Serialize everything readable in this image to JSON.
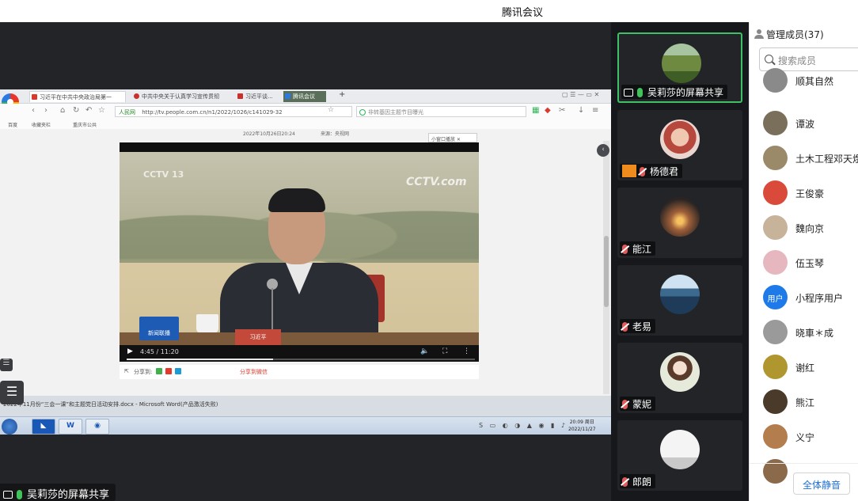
{
  "title": "腾讯会议",
  "stage": {
    "sharer_label": "吴莉莎的屏幕共享",
    "browser": {
      "tabs": [
        {
          "label": "习近平在中共中央政治局第一",
          "icon_color": "#d83a2e"
        },
        {
          "label": "中共中央关于认真学习宣传贯彻",
          "icon_color": "#c9302c"
        },
        {
          "label": "习近平谈...",
          "icon_color": "#c9302c"
        },
        {
          "label": "腾讯会议",
          "icon_color": "#2a7ae2"
        }
      ],
      "url_site": "人民网",
      "url": "http://tv.people.com.cn/n1/2022/1026/c141029-32",
      "search_text": "非转基因主题节目曝光",
      "bookmarks": [
        "百度",
        "收藏夹栏",
        "重庆市公共"
      ],
      "page_date": "2022年10月26日20:24",
      "page_source": "来源：央视网",
      "mini_window": "小窗口播放",
      "video": {
        "channel_logo": "CCTV.com",
        "channel_number": "CCTV 13",
        "news_logo": "新闻联播",
        "nameplate": "习近平",
        "time": "4:45 / 11:20",
        "progress": 0.42
      },
      "share_label": "分享到:",
      "wechat_share": "分享到微信",
      "doc_item": "2022年11月份“三会一课”和主题党日活动安排.docx - Microsoft Word(产品激活失败)",
      "clock_time": "20:09 周日",
      "clock_date": "2022/11/27",
      "taskbar_word": "W"
    }
  },
  "video_tiles": [
    {
      "name": "吴莉莎的屏幕共享",
      "avatar": "field",
      "mic": "on",
      "active": true
    },
    {
      "name": "杨德君",
      "avatar": "baby",
      "mic": "muted",
      "badge": true
    },
    {
      "name": "能江",
      "avatar": "sunset",
      "mic": "muted"
    },
    {
      "name": "老易",
      "avatar": "lake",
      "mic": "muted"
    },
    {
      "name": "蒙妮",
      "avatar": "girl",
      "mic": "muted"
    },
    {
      "name": "郎朗",
      "avatar": "white",
      "mic": "muted"
    }
  ],
  "panel": {
    "title": "管理成员(37)",
    "search_placeholder": "搜索成员",
    "members": [
      {
        "name": "顺其自然",
        "avatar_color": "#8a8a8a"
      },
      {
        "name": "谭波",
        "avatar_color": "#7a6f5a"
      },
      {
        "name": "土木工程邓天煜",
        "avatar_color": "#9a8a6a"
      },
      {
        "name": "王俊豪",
        "avatar_color": "#d94a3a"
      },
      {
        "name": "魏向京",
        "avatar_color": "#c7b29a"
      },
      {
        "name": "伍玉琴",
        "avatar_color": "#e7b7c0"
      },
      {
        "name": "小程序用户",
        "avatar_color": "#1e7ae8",
        "avatar_text": "用户"
      },
      {
        "name": "晓車＊成",
        "avatar_color": "#9a9a9a"
      },
      {
        "name": "谢红",
        "avatar_color": "#b0962e"
      },
      {
        "name": "熊江",
        "avatar_color": "#4a3a2a"
      },
      {
        "name": "义宁",
        "avatar_color": "#b37d4e"
      },
      {
        "name": "",
        "avatar_color": "#8a6a4a"
      }
    ],
    "mute_all": "全体静音"
  },
  "colors": {
    "accent_green": "#3fbf66",
    "accent_blue": "#1e6fd9",
    "stage_bg": "#232427"
  }
}
